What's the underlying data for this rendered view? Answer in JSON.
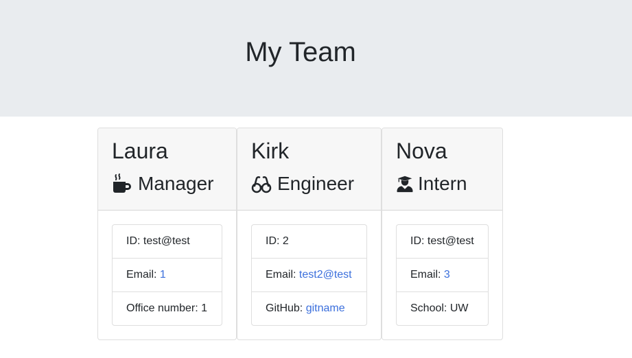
{
  "header": {
    "title": "My Team"
  },
  "employees": [
    {
      "name": "Laura",
      "role": "Manager",
      "icon": "mug-hot-icon",
      "id_label": "ID:",
      "id_value": "test@test",
      "email_label": "Email:",
      "email_value": "1",
      "extra_label": "Office number:",
      "extra_value": "1"
    },
    {
      "name": "Kirk",
      "role": "Engineer",
      "icon": "glasses-icon",
      "id_label": "ID:",
      "id_value": "2",
      "email_label": "Email:",
      "email_value": "test2@test",
      "extra_label": "GitHub:",
      "extra_value": "gitname"
    },
    {
      "name": "Nova",
      "role": "Intern",
      "icon": "user-graduate-icon",
      "id_label": "ID:",
      "id_value": "test@test",
      "email_label": "Email:",
      "email_value": "3",
      "extra_label": "School:",
      "extra_value": "UW"
    }
  ],
  "colors": {
    "jumbotron_bg": "#e9ecef",
    "card_header_bg": "#f7f7f7",
    "link": "#3b6fdc",
    "text": "#212529"
  }
}
